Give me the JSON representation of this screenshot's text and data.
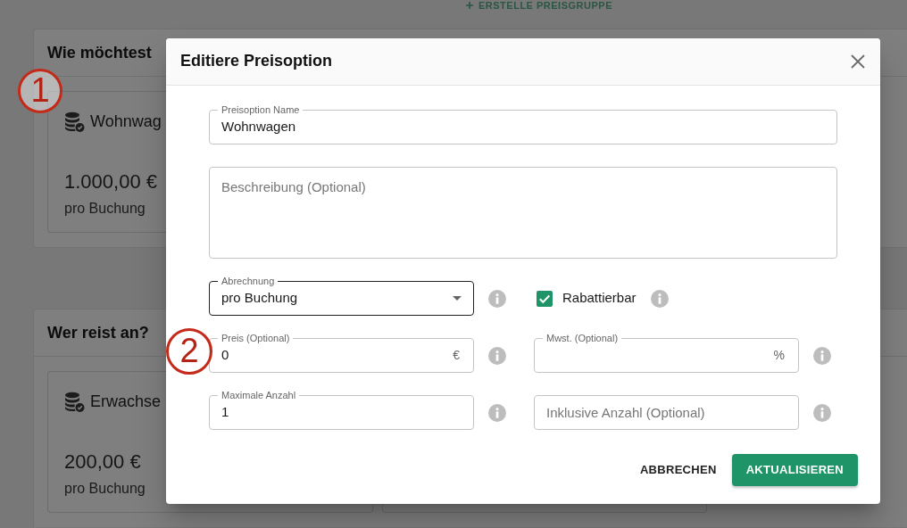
{
  "page_header": {
    "action_label": "ERSTELLE PREISGRUPPE"
  },
  "sections": [
    {
      "title": "Wie möchtest",
      "cards": [
        {
          "kind": "price",
          "title": "Wohnwag",
          "price": "1.000,00 €",
          "unit": "pro Buchung",
          "marker": "1"
        }
      ]
    },
    {
      "title": "Wer reist an?",
      "cards": [
        {
          "kind": "price",
          "title": "Erwachse",
          "price": "200,00 €",
          "unit": "pro Buchung"
        },
        {
          "kind": "covered"
        }
      ]
    }
  ],
  "dialog": {
    "title": "Editiere Preisoption",
    "name_field": {
      "label": "Preisoption Name",
      "value": "Wohnwagen"
    },
    "description_field": {
      "placeholder": "Beschreibung (Optional)"
    },
    "billing_select": {
      "label": "Abrechnung",
      "value": "pro Buchung",
      "focused": true
    },
    "discountable": {
      "label": "Rabattierbar",
      "checked": true
    },
    "price_field": {
      "label": "Preis (Optional)",
      "value": "0",
      "suffix": "€",
      "marker": "2"
    },
    "vat_field": {
      "label": "Mwst. (Optional)",
      "suffix": "%"
    },
    "max_count_field": {
      "label": "Maximale Anzahl",
      "value": "1"
    },
    "included_count_field": {
      "placeholder": "Inklusive Anzahl (Optional)"
    },
    "buttons": [
      {
        "kind": "text",
        "label": "ABBRECHEN"
      },
      {
        "kind": "primary",
        "label": "AKTUALISIEREN"
      }
    ]
  }
}
